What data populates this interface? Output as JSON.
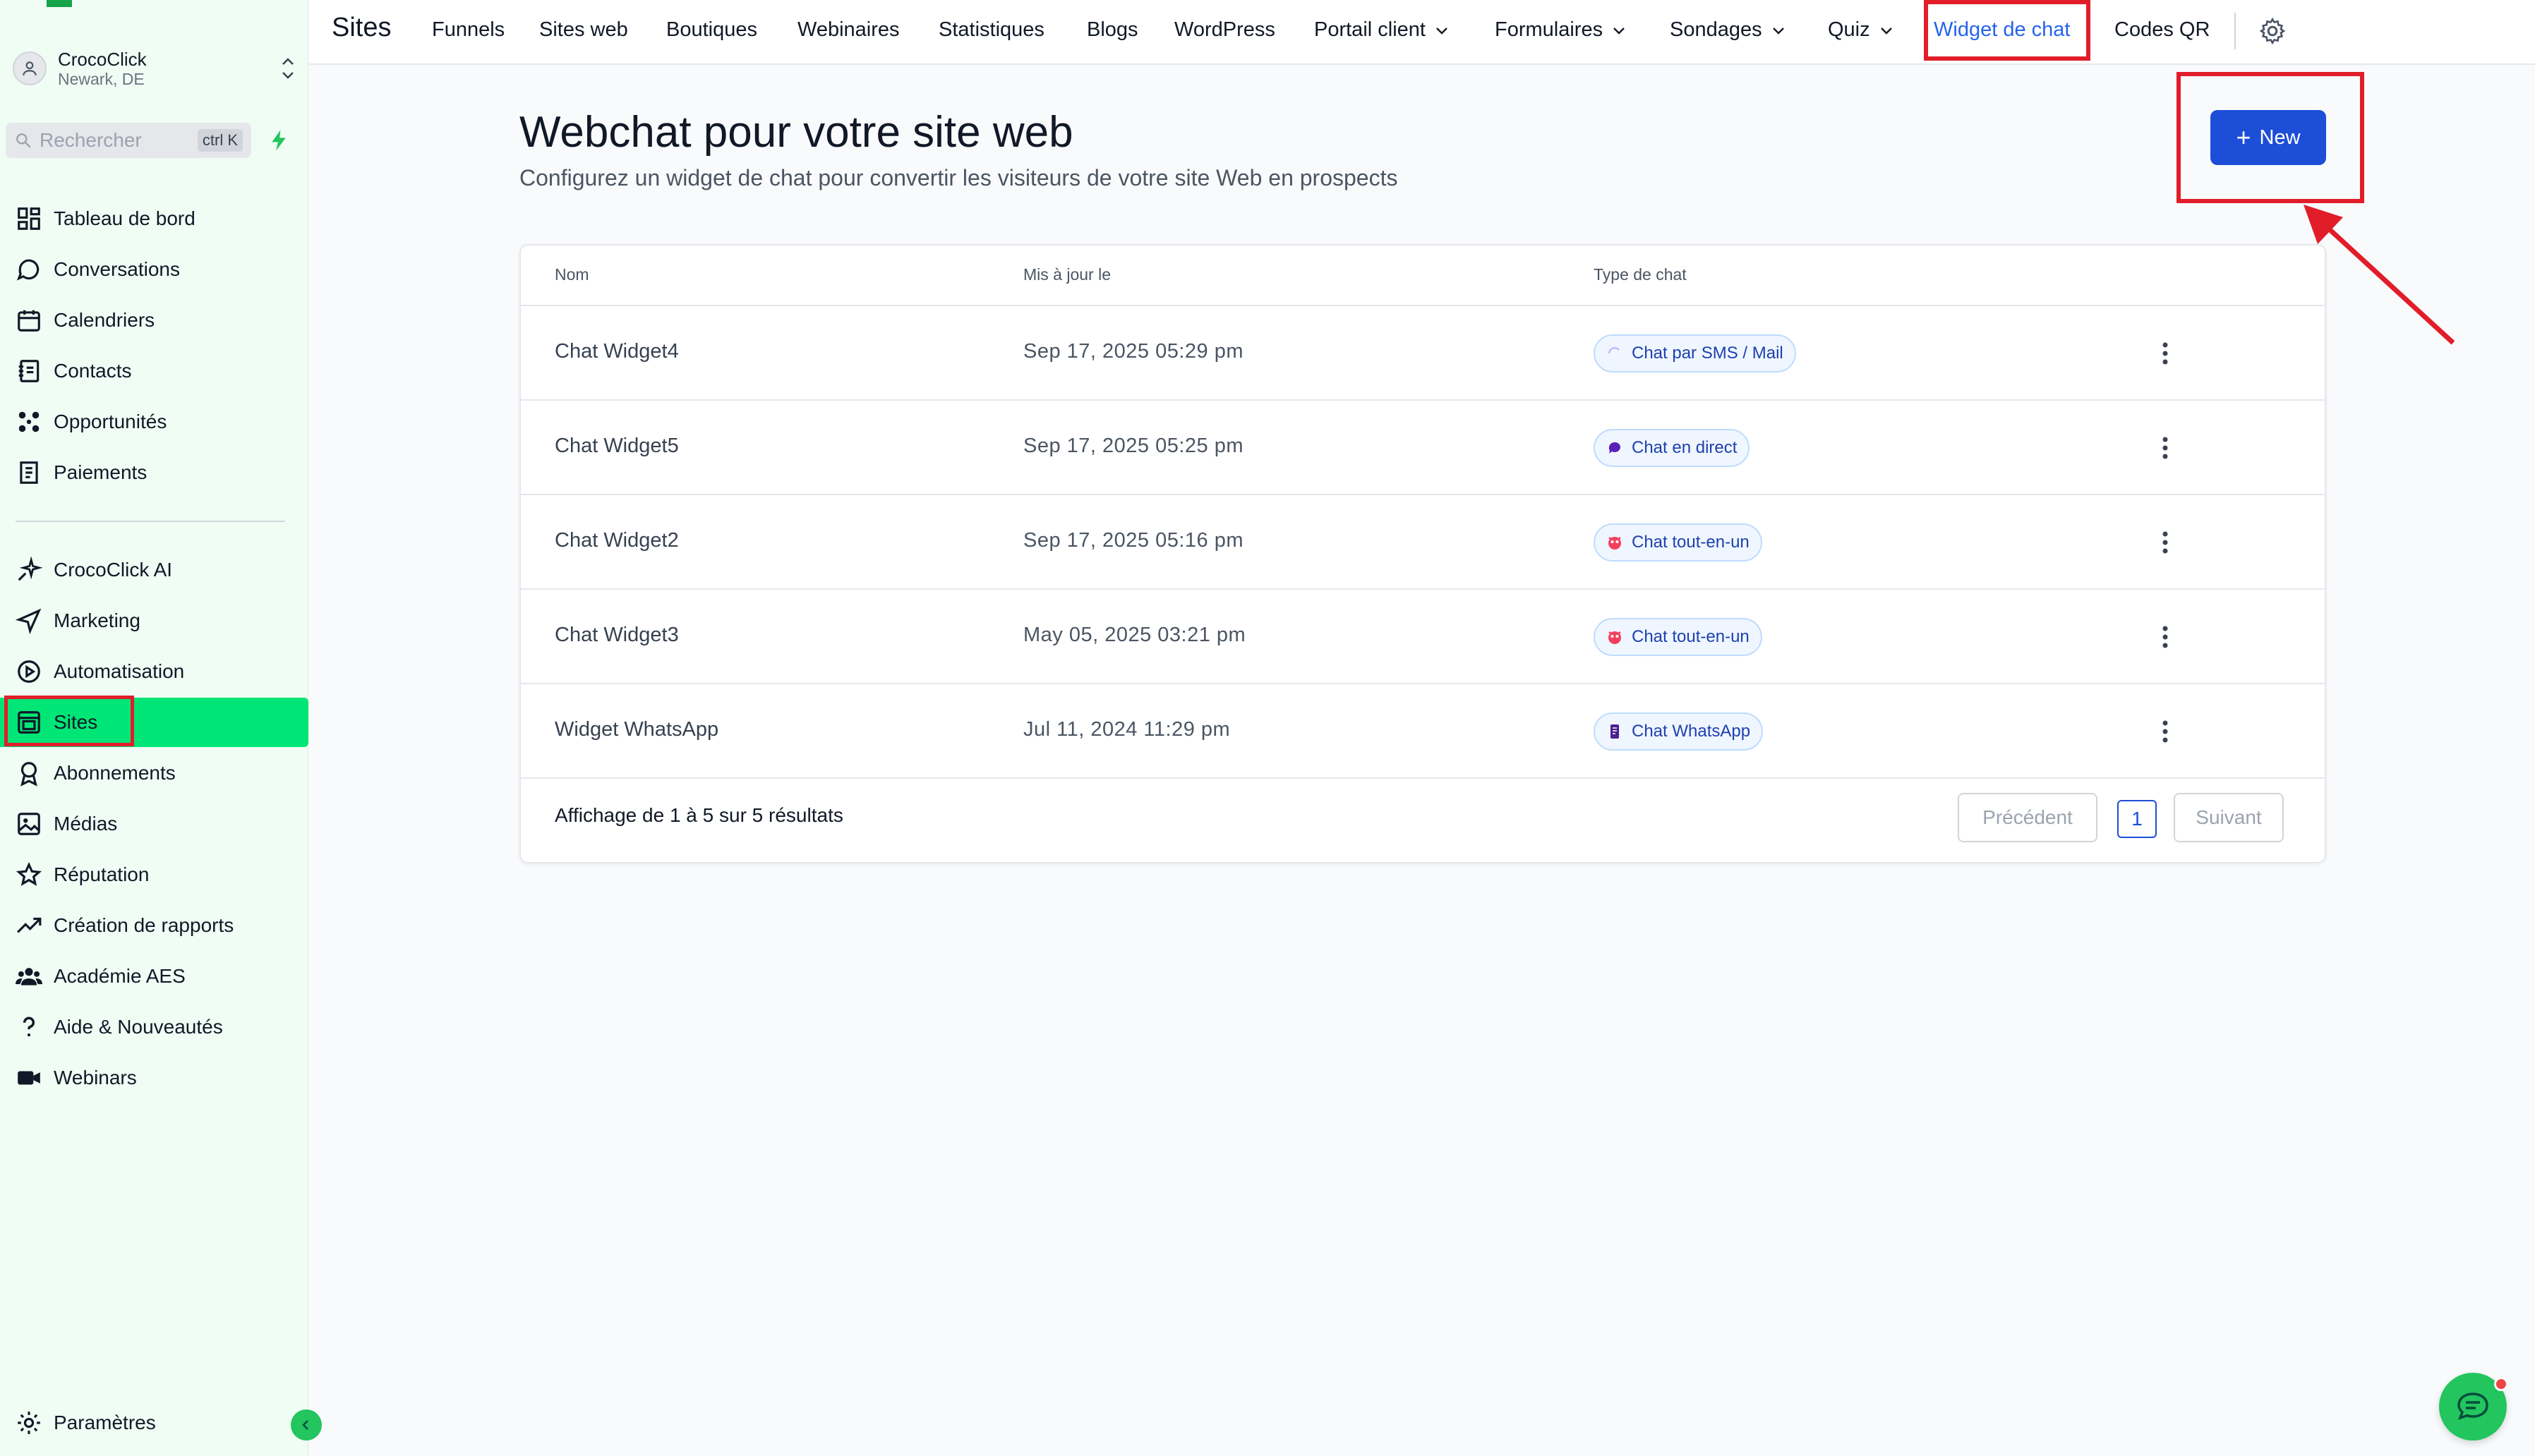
{
  "account": {
    "name": "CrocoClick",
    "location": "Newark, DE"
  },
  "search": {
    "placeholder": "Rechercher",
    "shortcut": "ctrl K"
  },
  "sidebar": {
    "items": [
      {
        "label": "Tableau de bord",
        "icon": "dashboard-icon"
      },
      {
        "label": "Conversations",
        "icon": "chat-bubble-icon"
      },
      {
        "label": "Calendriers",
        "icon": "calendar-icon"
      },
      {
        "label": "Contacts",
        "icon": "contacts-icon"
      },
      {
        "label": "Opportunités",
        "icon": "opportunities-icon"
      },
      {
        "label": "Paiements",
        "icon": "payments-icon"
      },
      {
        "label": "CrocoClick AI",
        "icon": "sparkle-icon"
      },
      {
        "label": "Marketing",
        "icon": "send-icon"
      },
      {
        "label": "Automatisation",
        "icon": "automation-icon"
      },
      {
        "label": "Sites",
        "icon": "sites-icon"
      },
      {
        "label": "Abonnements",
        "icon": "badge-icon"
      },
      {
        "label": "Médias",
        "icon": "image-icon"
      },
      {
        "label": "Réputation",
        "icon": "star-icon"
      },
      {
        "label": "Création de rapports",
        "icon": "trend-icon"
      },
      {
        "label": "Académie AES",
        "icon": "users-icon"
      },
      {
        "label": "Aide & Nouveautés",
        "icon": "question-icon"
      },
      {
        "label": "Webinars",
        "icon": "video-icon"
      }
    ],
    "settings_label": "Paramètres",
    "active": "Sites"
  },
  "topbar": {
    "title": "Sites",
    "tabs": [
      {
        "label": "Funnels"
      },
      {
        "label": "Sites web"
      },
      {
        "label": "Boutiques"
      },
      {
        "label": "Webinaires"
      },
      {
        "label": "Statistiques"
      },
      {
        "label": "Blogs"
      },
      {
        "label": "WordPress"
      },
      {
        "label": "Portail client"
      },
      {
        "label": "Formulaires"
      },
      {
        "label": "Sondages"
      },
      {
        "label": "Quiz"
      },
      {
        "label": "Widget de chat"
      },
      {
        "label": "Codes QR"
      }
    ],
    "active_tab": "Widget de chat"
  },
  "page": {
    "title": "Webchat pour votre site web",
    "subtitle": "Configurez un widget de chat pour convertir les visiteurs de votre site Web en prospects",
    "new_button": "New"
  },
  "table": {
    "headers": [
      "Nom",
      "Mis à jour le",
      "Type de chat"
    ],
    "rows": [
      {
        "name": "Chat Widget4",
        "updated": "Sep 17, 2025 05:29 pm",
        "type": "Chat par SMS / Mail",
        "type_icon": "sms-mail-icon"
      },
      {
        "name": "Chat Widget5",
        "updated": "Sep 17, 2025 05:25 pm",
        "type": "Chat en direct",
        "type_icon": "live-chat-icon"
      },
      {
        "name": "Chat Widget2",
        "updated": "Sep 17, 2025 05:16 pm",
        "type": "Chat tout-en-un",
        "type_icon": "all-in-one-icon"
      },
      {
        "name": "Chat Widget3",
        "updated": "May 05, 2025 03:21 pm",
        "type": "Chat tout-en-un",
        "type_icon": "all-in-one-icon"
      },
      {
        "name": "Widget WhatsApp",
        "updated": "Jul 11, 2024 11:29 pm",
        "type": "Chat WhatsApp",
        "type_icon": "whatsapp-icon"
      }
    ],
    "footer": "Affichage de 1 à 5 sur 5 résultats",
    "pagination": {
      "prev": "Précédent",
      "current": "1",
      "next": "Suivant"
    }
  },
  "colors": {
    "accent": "#1d4ed8",
    "sidebar_bg": "#f0fdf4",
    "active_nav": "#00e676",
    "highlight": "#e11d2a"
  }
}
